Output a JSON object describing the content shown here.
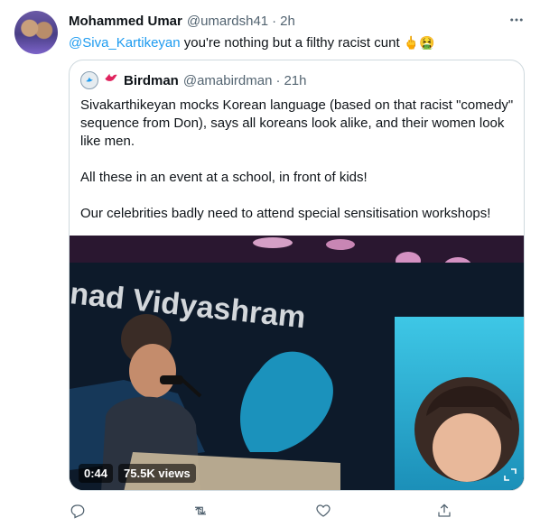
{
  "tweet": {
    "author_name": "Mohammed Umar",
    "author_handle": "@umardsh41",
    "separator": "·",
    "time": "2h",
    "mention": "@Siva_Kartikeyan",
    "text": " you're nothing but a filthy racist cunt ",
    "emojis": "🖕🤮"
  },
  "quoted": {
    "author_name": "Birdman",
    "author_handle": "@amabirdman",
    "separator": "·",
    "time": "21h",
    "paragraphs": [
      "Sivakarthikeyan mocks Korean language (based on that racist \"comedy\" sequence from Don), says all koreans look alike, and their women look like men.",
      "All these in an event at a school, in front of kids!",
      "Our celebrities badly need to attend special sensitisation workshops!"
    ],
    "video": {
      "duration": "0:44",
      "views": "75.5K views",
      "banner_text": "inad Vidyashram"
    }
  },
  "icons": {
    "more": "more-icon",
    "reply": "reply-icon",
    "retweet": "retweet-icon",
    "like": "heart-icon",
    "share": "share-icon"
  },
  "colors": {
    "link": "#1d9bf0",
    "secondary_text": "#536471",
    "border": "#cfd9de"
  }
}
